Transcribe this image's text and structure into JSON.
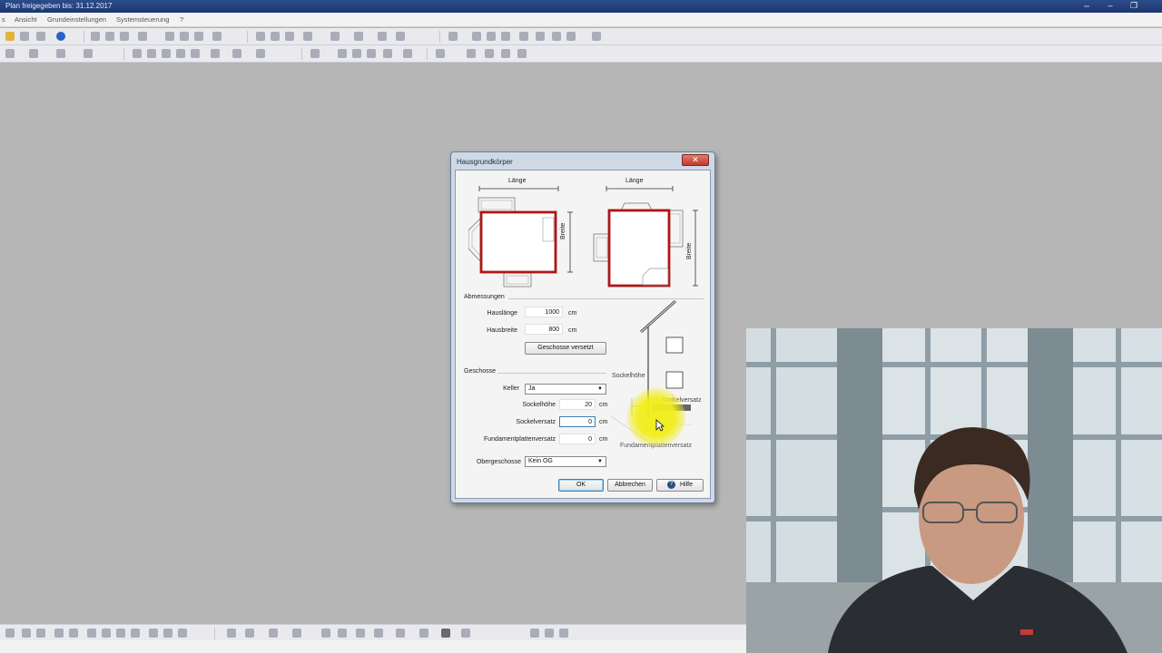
{
  "window": {
    "title": "Plan freigegeben bis: 31.12.2017",
    "controls": [
      "⇔",
      "–",
      "❐"
    ]
  },
  "menu": {
    "items": [
      "s",
      "Ansicht",
      "Grundeinstellungen",
      "Systemsteuerung",
      "?"
    ]
  },
  "dialog": {
    "title": "Hausgrundkörper",
    "close_label": "✕",
    "diagram": {
      "length_label": "Länge",
      "width_label": "Breite",
      "socket_height_label": "Sockelhöhe",
      "socket_offset_label": "Sockelversatz",
      "foundation_offset_label": "Fundamentplattenversatz"
    },
    "sections": {
      "dimensions": "Abmessungen",
      "floors": "Geschosse"
    },
    "fields": {
      "house_length": {
        "label": "Hauslänge",
        "value": "1000",
        "unit": "cm"
      },
      "house_width": {
        "label": "Hausbreite",
        "value": "800",
        "unit": "cm"
      },
      "basement": {
        "label": "Keller",
        "value": "Ja"
      },
      "socket_height": {
        "label": "Sockelhöhe",
        "value": "20",
        "unit": "cm"
      },
      "socket_offset": {
        "label": "Sockelversatz",
        "value": "0",
        "unit": "cm"
      },
      "foundation_offset": {
        "label": "Fundamentplattenversatz",
        "value": "0",
        "unit": "cm"
      },
      "upper_floors": {
        "label": "Obergeschosse",
        "value": "Kein OG"
      }
    },
    "buttons": {
      "offset_floors": "Geschosse versetzt",
      "ok": "OK",
      "cancel": "Abbrechen",
      "help": "Hilfe"
    }
  },
  "colors": {
    "house_outline": "#b01515",
    "cursor_highlight": "#f2ee1a",
    "title_bar": "#1f3a78"
  }
}
